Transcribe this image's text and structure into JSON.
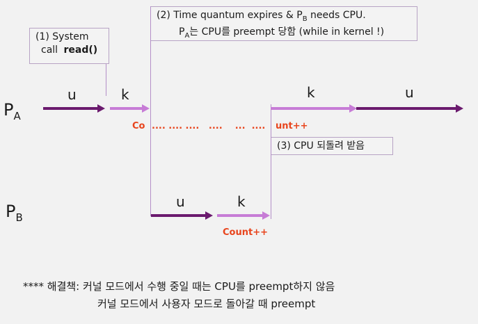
{
  "box1": {
    "line1": "(1) System",
    "line2_prefix": "call",
    "line2_bold": "read()"
  },
  "box2": {
    "line1": "(2) Time quantum expires & P",
    "line1_sub": "B",
    "line1_suffix": " needs CPU.",
    "line2_pre": "P",
    "line2_sub": "A",
    "line2_rest": "는 CPU를 preempt 당함 (while in kernel !)"
  },
  "box3": {
    "text": "(3) CPU 되돌려 받음"
  },
  "processA": {
    "name": "P",
    "sub": "A",
    "u1": "u",
    "k1": "k",
    "k2": "k",
    "u2": "u",
    "count_start": "Co",
    "count_dots": ".... .... ....   ....    ...  ....",
    "count_end": "unt++"
  },
  "processB": {
    "name": "P",
    "sub": "B",
    "u": "u",
    "k": "k",
    "count": "Count++"
  },
  "footer": {
    "line1": "**** 해결책: 커널 모드에서 수행 중일 때는 CPU를 preempt하지 않음",
    "line2": "커널 모드에서 사용자 모드로 돌아갈 때 preempt"
  }
}
